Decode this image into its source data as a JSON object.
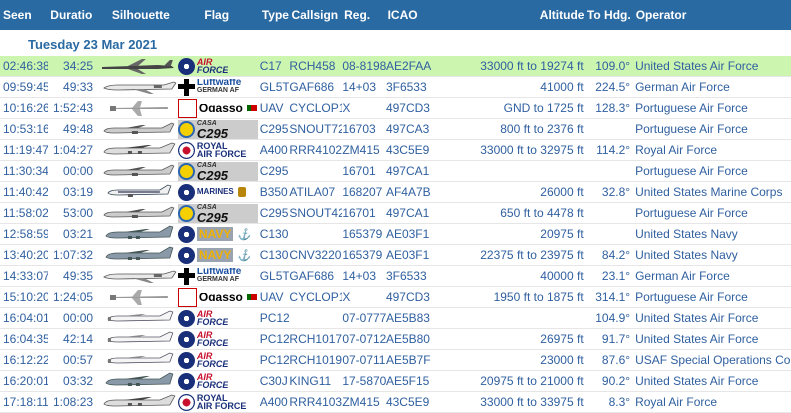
{
  "columns": {
    "seen": "Seen",
    "duration": "Duration",
    "silhouette": "Silhouette",
    "flag": "Flag",
    "type": "Type",
    "callsign": "Callsign",
    "reg": "Reg.",
    "icao": "ICAO",
    "altitude": "Altitude",
    "to_hdg": "To Hdg.",
    "operator": "Operator"
  },
  "date_label": "Tuesday 23 Mar 2021",
  "colors": {
    "header_bg": "#2a6aa3",
    "row_text": "#3060a0",
    "highlight_row": "#ccf5b0"
  },
  "rows": [
    {
      "seen": "02:46:38",
      "duration": "34:25",
      "silhouette": "c17-jet",
      "flag": "usaf",
      "flag_text": [
        "AIR",
        "FORCE"
      ],
      "type": "C17",
      "callsign": "RCH458",
      "reg": "08-8198",
      "icao": "AE2FAA",
      "altitude": "33000 ft to 19274 ft",
      "hdg": "109.0°",
      "operator": "United States Air Force",
      "highlight": true
    },
    {
      "seen": "09:59:45",
      "duration": "49:33",
      "silhouette": "business-jet",
      "flag": "luftwaffe",
      "flag_text": [
        "Luftwaffe",
        "GERMAN AF"
      ],
      "type": "GL5T",
      "callsign": "GAF686",
      "reg": "14+03",
      "icao": "3F6533",
      "altitude": "41000 ft",
      "hdg": "224.5°",
      "operator": "German Air Force"
    },
    {
      "seen": "10:16:26",
      "duration": "1:52:43",
      "silhouette": "uav",
      "flag": "portugal",
      "flag_text": [
        "Ogasso",
        ""
      ],
      "type": "UAV",
      "callsign": "CYCLOP1",
      "reg": "X",
      "icao": "497CD3",
      "altitude": "GND to 1725 ft",
      "hdg": "128.3°",
      "operator": "Portuguese Air Force"
    },
    {
      "seen": "10:53:16",
      "duration": "49:48",
      "silhouette": "turboprop",
      "flag": "casa",
      "flag_text": [
        "CASA",
        "C295"
      ],
      "type": "C295",
      "callsign": "SNOUT72",
      "reg": "16703",
      "icao": "497CA3",
      "altitude": "800 ft to 2376 ft",
      "hdg": "",
      "operator": "Portuguese Air Force"
    },
    {
      "seen": "11:19:47",
      "duration": "1:04:27",
      "silhouette": "a400",
      "flag": "raf",
      "flag_text": [
        "ROYAL",
        "AIR FORCE"
      ],
      "type": "A400",
      "callsign": "RRR4102",
      "reg": "ZM415",
      "icao": "43C5E9",
      "altitude": "33000 ft to 32975 ft",
      "hdg": "114.2°",
      "operator": "Royal Air Force"
    },
    {
      "seen": "11:30:34",
      "duration": "00:00",
      "silhouette": "turboprop",
      "flag": "casa",
      "flag_text": [
        "CASA",
        "C295"
      ],
      "type": "C295",
      "callsign": "",
      "reg": "16701",
      "icao": "497CA1",
      "altitude": "",
      "hdg": "",
      "operator": "Portuguese Air Force"
    },
    {
      "seen": "11:40:42",
      "duration": "03:19",
      "silhouette": "kingair",
      "flag": "marines",
      "flag_text": [
        "MARINES",
        ""
      ],
      "type": "B350",
      "callsign": "ATILA07",
      "reg": "168207",
      "icao": "AF4A7B",
      "altitude": "26000 ft",
      "hdg": "32.8°",
      "operator": "United States Marine Corps"
    },
    {
      "seen": "11:58:02",
      "duration": "53:00",
      "silhouette": "turboprop",
      "flag": "casa",
      "flag_text": [
        "CASA",
        "C295"
      ],
      "type": "C295",
      "callsign": "SNOUT42",
      "reg": "16701",
      "icao": "497CA1",
      "altitude": "650 ft to 4478 ft",
      "hdg": "",
      "operator": "Portuguese Air Force"
    },
    {
      "seen": "12:58:59",
      "duration": "03:21",
      "silhouette": "c130",
      "flag": "navy",
      "flag_text": [
        "NAVY",
        ""
      ],
      "type": "C130",
      "callsign": "",
      "reg": "165379",
      "icao": "AE03F1",
      "altitude": "20975 ft",
      "hdg": "",
      "operator": "United States Navy"
    },
    {
      "seen": "13:40:20",
      "duration": "1:07:32",
      "silhouette": "c130",
      "flag": "navy",
      "flag_text": [
        "NAVY",
        ""
      ],
      "type": "C130",
      "callsign": "CNV3220",
      "reg": "165379",
      "icao": "AE03F1",
      "altitude": "22375 ft to 23975 ft",
      "hdg": "84.2°",
      "operator": "United States Navy"
    },
    {
      "seen": "14:33:07",
      "duration": "49:35",
      "silhouette": "business-jet",
      "flag": "luftwaffe",
      "flag_text": [
        "Luftwaffe",
        "GERMAN AF"
      ],
      "type": "GL5T",
      "callsign": "GAF686",
      "reg": "14+03",
      "icao": "3F6533",
      "altitude": "40000 ft",
      "hdg": "23.1°",
      "operator": "German Air Force"
    },
    {
      "seen": "15:10:20",
      "duration": "1:24:05",
      "silhouette": "uav",
      "flag": "portugal",
      "flag_text": [
        "Ogasso",
        ""
      ],
      "type": "UAV",
      "callsign": "CYCLOP1",
      "reg": "X",
      "icao": "497CD3",
      "altitude": "1950 ft to 1875 ft",
      "hdg": "314.1°",
      "operator": "Portuguese Air Force"
    },
    {
      "seen": "16:04:01",
      "duration": "00:00",
      "silhouette": "pc12",
      "flag": "usaf",
      "flag_text": [
        "AIR",
        "FORCE"
      ],
      "type": "PC12",
      "callsign": "",
      "reg": "07-0777",
      "icao": "AE5B83",
      "altitude": "",
      "hdg": "104.9°",
      "operator": "United States Air Force"
    },
    {
      "seen": "16:04:35",
      "duration": "42:14",
      "silhouette": "pc12",
      "flag": "usaf",
      "flag_text": [
        "AIR",
        "FORCE"
      ],
      "type": "PC12",
      "callsign": "RCH1017",
      "reg": "07-0712",
      "icao": "AE5B80",
      "altitude": "26975 ft",
      "hdg": "91.7°",
      "operator": "United States Air Force"
    },
    {
      "seen": "16:12:22",
      "duration": "00:57",
      "silhouette": "pc12",
      "flag": "usaf",
      "flag_text": [
        "AIR",
        "FORCE"
      ],
      "type": "PC12",
      "callsign": "RCH1019",
      "reg": "07-0711",
      "icao": "AE5B7F",
      "altitude": "23000 ft",
      "hdg": "87.6°",
      "operator": "USAF Special Operations Comma"
    },
    {
      "seen": "16:20:01",
      "duration": "03:32",
      "silhouette": "c130",
      "flag": "usaf",
      "flag_text": [
        "AIR",
        "FORCE"
      ],
      "type": "C30J",
      "callsign": "KING11",
      "reg": "17-5870",
      "icao": "AE5F15",
      "altitude": "20975 ft to 21000 ft",
      "hdg": "90.2°",
      "operator": "United States Air Force"
    },
    {
      "seen": "17:18:11",
      "duration": "1:08:23",
      "silhouette": "a400",
      "flag": "raf",
      "flag_text": [
        "ROYAL",
        "AIR FORCE"
      ],
      "type": "A400",
      "callsign": "RRR4103",
      "reg": "ZM415",
      "icao": "43C5E9",
      "altitude": "33000 ft to 33975 ft",
      "hdg": "8.3°",
      "operator": "Royal Air Force"
    }
  ]
}
